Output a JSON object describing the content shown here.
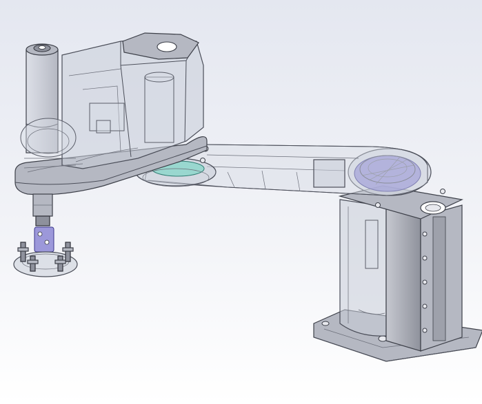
{
  "scene": {
    "description_visible_text": "",
    "colors": {
      "background_top": "#e6e9f2",
      "background_bottom": "#ffffff",
      "glass": "#c9cdd8",
      "metal": "#b5b8c2",
      "purple_accent": "#7f7ad0",
      "teal_accent": "#7fd6c8"
    },
    "parts": [
      "base-column",
      "base-flange-plate",
      "joint1-motor-ring",
      "arm1-link",
      "joint2-housing",
      "arm2-housing",
      "z-spindle-column",
      "end-effector-gripper"
    ]
  }
}
